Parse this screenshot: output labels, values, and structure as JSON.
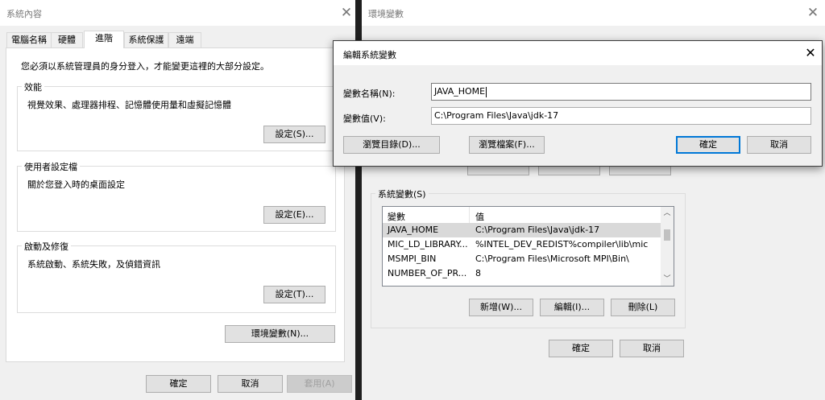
{
  "sysprops": {
    "title": "系統內容",
    "tabs": [
      "電腦名稱",
      "硬體",
      "進階",
      "系統保護",
      "遠端"
    ],
    "admin_note": "您必須以系統管理員的身分登入，才能變更這裡的大部分設定。",
    "performance": {
      "legend": "效能",
      "desc": "視覺效果、處理器排程、記憶體使用量和虛擬記憶體",
      "button": "設定(S)..."
    },
    "profiles": {
      "legend": "使用者設定檔",
      "desc": "關於您登入時的桌面設定",
      "button": "設定(E)..."
    },
    "startup": {
      "legend": "啟動及修復",
      "desc": "系統啟動、系統失敗，及偵錯資訊",
      "button": "設定(T)..."
    },
    "env_button": "環境變數(N)...",
    "ok": "確定",
    "cancel": "取消",
    "apply": "套用(A)"
  },
  "envvars": {
    "title": "環境變數",
    "system_group": "系統變數(S)",
    "columns": [
      "變數",
      "值"
    ],
    "rows": [
      {
        "name": "JAVA_HOME",
        "value": "C:\\Program Files\\Java\\jdk-17"
      },
      {
        "name": "MIC_LD_LIBRARY...",
        "value": "%INTEL_DEV_REDIST%compiler\\lib\\mic"
      },
      {
        "name": "MSMPI_BIN",
        "value": "C:\\Program Files\\Microsoft MPI\\Bin\\"
      },
      {
        "name": "NUMBER_OF_PR...",
        "value": "8"
      }
    ],
    "new": "新增(W)...",
    "edit": "編輯(I)...",
    "delete": "刪除(L)",
    "ok": "確定",
    "cancel": "取消"
  },
  "editdlg": {
    "title": "編輯系統變數",
    "name_label": "變數名稱(N):",
    "name_value": "JAVA_HOME",
    "value_label": "變數值(V):",
    "value_value": "C:\\Program Files\\Java\\jdk-17",
    "browse_dir": "瀏覽目錄(D)...",
    "browse_file": "瀏覽檔案(F)...",
    "ok": "確定",
    "cancel": "取消"
  },
  "icons": {
    "close": "close-icon",
    "scroll_up": "chevron-up-icon",
    "scroll_down": "chevron-down-icon"
  }
}
